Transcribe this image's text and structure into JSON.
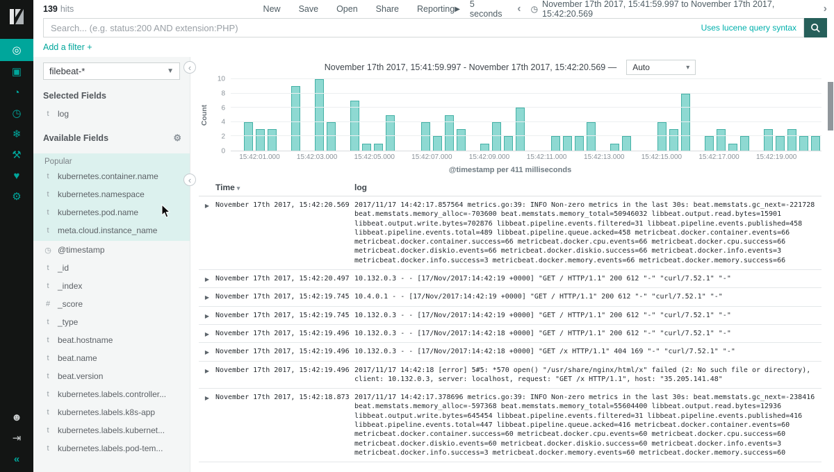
{
  "header": {
    "hits_count": "139",
    "hits_label": "hits",
    "nav": [
      "New",
      "Save",
      "Open",
      "Share",
      "Reporting"
    ],
    "play_icon": "▶",
    "refresh_interval": "5 seconds",
    "prev_icon": "‹",
    "next_icon": "›",
    "clock_icon": "◷",
    "time_range": "November 17th 2017, 15:41:59.997 to November 17th 2017, 15:42:20.569"
  },
  "search": {
    "placeholder": "Search... (e.g. status:200 AND extension:PHP)",
    "syntax_hint": "Uses lucene query syntax"
  },
  "filters": {
    "add_filter": "Add a filter +"
  },
  "sidebar": {
    "apps": [
      {
        "name": "discover",
        "glyph": "◎",
        "active": true
      },
      {
        "name": "visualize",
        "glyph": "▣",
        "active": false
      },
      {
        "name": "dashboard",
        "glyph": "◔",
        "active": false
      },
      {
        "name": "timelion",
        "glyph": "◷",
        "active": false
      },
      {
        "name": "machine-learning",
        "glyph": "❄",
        "active": false
      },
      {
        "name": "dev-tools",
        "glyph": "⚒",
        "active": false
      },
      {
        "name": "monitoring",
        "glyph": "♥",
        "active": false
      },
      {
        "name": "management",
        "glyph": "⚙",
        "active": false
      }
    ],
    "bottom": [
      {
        "name": "account",
        "glyph": "☻"
      },
      {
        "name": "logout",
        "glyph": "⇥"
      },
      {
        "name": "collapse-nav",
        "glyph": "«"
      }
    ]
  },
  "fields_panel": {
    "index_pattern": "filebeat-*",
    "selected_heading": "Selected Fields",
    "selected_fields": [
      {
        "badge": "t",
        "name": "log"
      }
    ],
    "available_heading": "Available Fields",
    "popular_heading": "Popular",
    "popular_fields": [
      {
        "badge": "t",
        "name": "kubernetes.container.name"
      },
      {
        "badge": "t",
        "name": "kubernetes.namespace"
      },
      {
        "badge": "t",
        "name": "kubernetes.pod.name"
      },
      {
        "badge": "t",
        "name": "meta.cloud.instance_name"
      }
    ],
    "fields": [
      {
        "badge": "◷",
        "name": "@timestamp"
      },
      {
        "badge": "t",
        "name": "_id"
      },
      {
        "badge": "t",
        "name": "_index"
      },
      {
        "badge": "#",
        "name": "_score"
      },
      {
        "badge": "t",
        "name": "_type"
      },
      {
        "badge": "t",
        "name": "beat.hostname"
      },
      {
        "badge": "t",
        "name": "beat.name"
      },
      {
        "badge": "t",
        "name": "beat.version"
      },
      {
        "badge": "t",
        "name": "kubernetes.labels.controller..."
      },
      {
        "badge": "t",
        "name": "kubernetes.labels.k8s-app"
      },
      {
        "badge": "t",
        "name": "kubernetes.labels.kubernet..."
      },
      {
        "badge": "t",
        "name": "kubernetes.labels.pod-tem..."
      }
    ]
  },
  "chart_data": {
    "type": "bar",
    "title": "November 17th 2017, 15:41:59.997 - November 17th 2017, 15:42:20.569 —",
    "interval_selected": "Auto",
    "interval_caret": "▾",
    "ylabel": "Count",
    "xlabel": "@timestamp per 411 milliseconds",
    "ylim": [
      0,
      10
    ],
    "yticks": [
      0,
      2,
      4,
      6,
      8,
      10
    ],
    "x_span_seconds": 20.572,
    "bucket_seconds": 0.411,
    "xtick_first_offset_seconds": 1.003,
    "xtick_step_seconds": 2,
    "xtick_labels": [
      "15:42:01.000",
      "15:42:03.000",
      "15:42:05.000",
      "15:42:07.000",
      "15:42:09.000",
      "15:42:11.000",
      "15:42:13.000",
      "15:42:15.000",
      "15:42:17.000",
      "15:42:19.000"
    ],
    "values": [
      0,
      4,
      3,
      3,
      0,
      9,
      0,
      10,
      4,
      0,
      7,
      1,
      1,
      5,
      0,
      0,
      4,
      2,
      5,
      3,
      0,
      1,
      4,
      2,
      6,
      0,
      0,
      2,
      2,
      2,
      4,
      0,
      1,
      2,
      0,
      0,
      4,
      3,
      8,
      0,
      2,
      3,
      1,
      2,
      0,
      3,
      2,
      3,
      2,
      2
    ]
  },
  "table": {
    "time_column": "Time",
    "sort_icon": "▾",
    "log_column": "log",
    "expand_icon": "▶",
    "rows": [
      {
        "time": "November 17th 2017, 15:42:20.569",
        "log": "2017/11/17 14:42:17.857564 metrics.go:39: INFO Non-zero metrics in the last 30s: beat.memstats.gc_next=-221728 beat.memstats.memory_alloc=-703600 beat.memstats.memory_total=50946032 libbeat.output.read.bytes=15901 libbeat.output.write.bytes=702876 libbeat.pipeline.events.filtered=31 libbeat.pipeline.events.published=458 libbeat.pipeline.events.total=489 libbeat.pipeline.queue.acked=458 metricbeat.docker.container.events=66 metricbeat.docker.container.success=66 metricbeat.docker.cpu.events=66 metricbeat.docker.cpu.success=66 metricbeat.docker.diskio.events=66 metricbeat.docker.diskio.success=66 metricbeat.docker.info.events=3 metricbeat.docker.info.success=3 metricbeat.docker.memory.events=66 metricbeat.docker.memory.success=66"
      },
      {
        "time": "November 17th 2017, 15:42:20.497",
        "log": "10.132.0.3 - - [17/Nov/2017:14:42:19 +0000] \"GET / HTTP/1.1\" 200 612 \"-\" \"curl/7.52.1\" \"-\""
      },
      {
        "time": "November 17th 2017, 15:42:19.745",
        "log": "10.4.0.1 - - [17/Nov/2017:14:42:19 +0000] \"GET / HTTP/1.1\" 200 612 \"-\" \"curl/7.52.1\" \"-\""
      },
      {
        "time": "November 17th 2017, 15:42:19.745",
        "log": "10.132.0.3 - - [17/Nov/2017:14:42:19 +0000] \"GET / HTTP/1.1\" 200 612 \"-\" \"curl/7.52.1\" \"-\""
      },
      {
        "time": "November 17th 2017, 15:42:19.496",
        "log": "10.132.0.3 - - [17/Nov/2017:14:42:18 +0000] \"GET / HTTP/1.1\" 200 612 \"-\" \"curl/7.52.1\" \"-\""
      },
      {
        "time": "November 17th 2017, 15:42:19.496",
        "log": "10.132.0.3 - - [17/Nov/2017:14:42:18 +0000] \"GET /x HTTP/1.1\" 404 169 \"-\" \"curl/7.52.1\" \"-\""
      },
      {
        "time": "November 17th 2017, 15:42:19.496",
        "log": "2017/11/17 14:42:18 [error] 5#5: *570 open() \"/usr/share/nginx/html/x\" failed (2: No such file or directory), client: 10.132.0.3, server: localhost, request: \"GET /x HTTP/1.1\", host: \"35.205.141.48\""
      },
      {
        "time": "November 17th 2017, 15:42:18.873",
        "log": "2017/11/17 14:42:17.378696 metrics.go:39: INFO Non-zero metrics in the last 30s: beat.memstats.gc_next=-238416 beat.memstats.memory_alloc=-597368 beat.memstats.memory_total=55604400 libbeat.output.read.bytes=12936 libbeat.output.write.bytes=645454 libbeat.pipeline.events.filtered=31 libbeat.pipeline.events.published=416 libbeat.pipeline.events.total=447 libbeat.pipeline.queue.acked=416 metricbeat.docker.container.events=60 metricbeat.docker.container.success=60 metricbeat.docker.cpu.events=60 metricbeat.docker.cpu.success=60 metricbeat.docker.diskio.events=60 metricbeat.docker.diskio.success=60 metricbeat.docker.info.events=3 metricbeat.docker.info.success=3 metricbeat.docker.memory.events=60 metricbeat.docker.memory.success=60"
      }
    ]
  },
  "colors": {
    "accent_teal": "#00a69b",
    "bar_fill": "#8ed9d2",
    "bar_border": "#43b0a5",
    "link_teal": "#00b0ac",
    "search_button": "#265f5a"
  }
}
